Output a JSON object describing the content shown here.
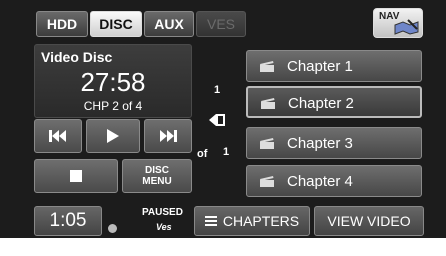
{
  "tabs": [
    {
      "label": "HDD",
      "state": "normal"
    },
    {
      "label": "DISC",
      "state": "active"
    },
    {
      "label": "AUX",
      "state": "normal"
    },
    {
      "label": "VES",
      "state": "disabled"
    }
  ],
  "nav_button": {
    "label": "NAV",
    "icon": "map-icon"
  },
  "now_playing": {
    "source": "Video Disc",
    "time": "27:58",
    "chapter_info": "CHP 2 of 4"
  },
  "controls": {
    "prev_icon": "skip-back-icon",
    "play_icon": "play-icon",
    "next_icon": "skip-forward-icon",
    "stop_icon": "stop-icon",
    "disc_menu_label_1": "DISC",
    "disc_menu_label_2": "MENU"
  },
  "pager": {
    "page": "1",
    "of_label": "of",
    "total": "1"
  },
  "chapters": [
    {
      "label": "Chapter 1",
      "selected": false
    },
    {
      "label": "Chapter 2",
      "selected": true
    },
    {
      "label": "Chapter 3",
      "selected": false
    },
    {
      "label": "Chapter 4",
      "selected": false
    }
  ],
  "status_bar": {
    "clock": "1:05",
    "play_state": "PAUSED",
    "ves_label": "Ves",
    "chapters_label": "CHAPTERS",
    "view_video_label": "VIEW VIDEO"
  },
  "colors": {
    "background": "#1c1c1c",
    "button": "#555555",
    "active_tab": "#eeeeee",
    "text": "#ffffff"
  }
}
